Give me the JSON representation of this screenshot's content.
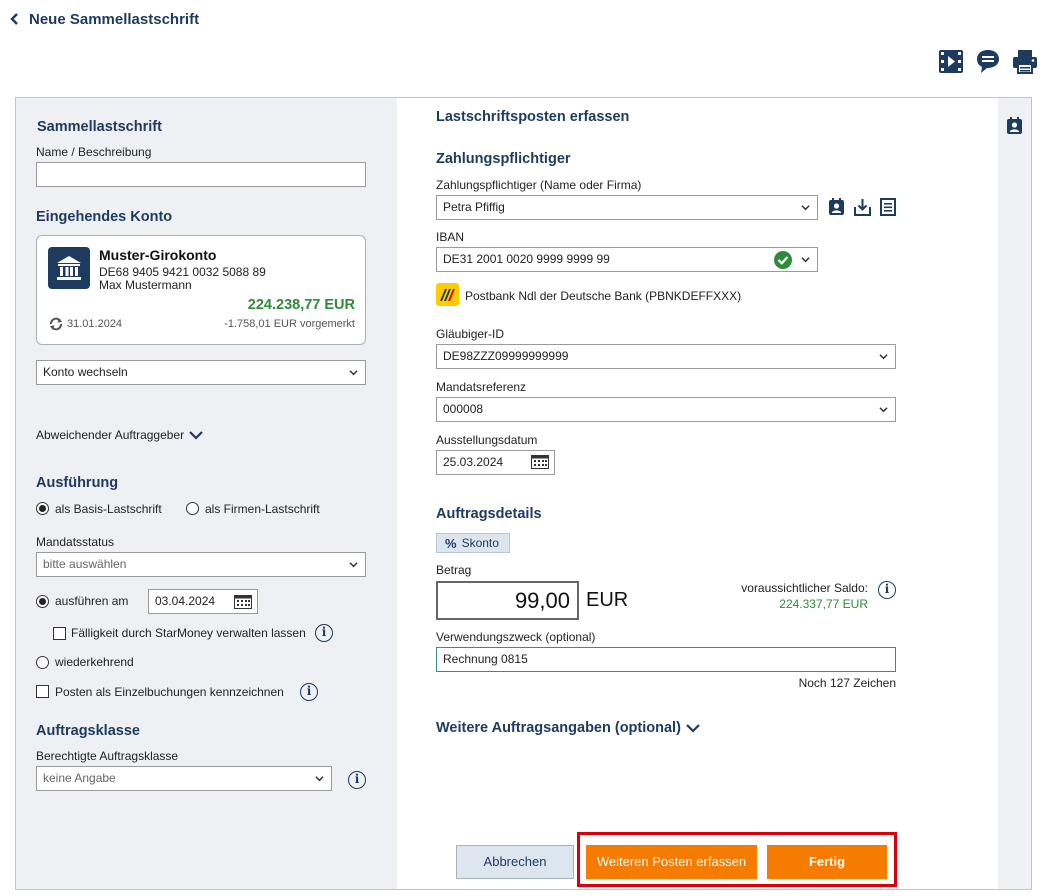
{
  "header": {
    "back_label": "Neue Sammellastschrift"
  },
  "toolbar": {
    "video_icon": "video-icon",
    "chat_icon": "chat-icon",
    "print_icon": "print-icon"
  },
  "left": {
    "section1_title": "Sammellastschrift",
    "name_label": "Name / Beschreibung",
    "name_value": "",
    "account_section_title": "Eingehendes Konto",
    "account": {
      "name": "Muster-Girokonto",
      "iban": "DE68 9405 9421 0032 5088 89",
      "holder": "Max Mustermann",
      "balance": "224.238,77 EUR",
      "date": "31.01.2024",
      "pending": "-1.758,01 EUR vorgemerkt"
    },
    "switch_account": "Konto wechseln",
    "different_payer": "Abweichender Auftraggeber",
    "execution_title": "Ausführung",
    "radio_basis": "als Basis-Lastschrift",
    "radio_firmen": "als Firmen-Lastschrift",
    "mandate_status_label": "Mandatsstatus",
    "mandate_status_placeholder": "bitte auswählen",
    "execute_on_label": "ausführen am",
    "execute_on_date": "03.04.2024",
    "due_manage_label": "Fälligkeit durch StarMoney verwalten lassen",
    "recurring_label": "wiederkehrend",
    "single_booking_label": "Posten als Einzelbuchungen kennzeichnen",
    "order_class_title": "Auftragsklasse",
    "order_class_label": "Berechtigte Auftragsklasse",
    "order_class_value": "keine Angabe"
  },
  "right": {
    "title": "Lastschriftsposten erfassen",
    "payer_title": "Zahlungspflichtiger",
    "payer_label": "Zahlungspflichtiger (Name oder Firma)",
    "payer_value": "Petra Pfiffig",
    "iban_label": "IBAN",
    "iban_value": "DE31 2001 0020 9999 9999 99",
    "bank_name": "Postbank Ndl der Deutsche Bank",
    "bank_bic": "(PBNKDEFFXXX)",
    "creditor_label": "Gläubiger-ID",
    "creditor_value": "DE98ZZZ09999999999",
    "mandate_ref_label": "Mandatsreferenz",
    "mandate_ref_value": "000008",
    "issue_date_label": "Ausstellungsdatum",
    "issue_date_value": "25.03.2024",
    "details_title": "Auftragsdetails",
    "skonto_label": "Skonto",
    "amount_label": "Betrag",
    "amount_value": "99,00",
    "currency": "EUR",
    "expected_balance_label": "voraussichtlicher Saldo:",
    "expected_balance_value": "224.337,77 EUR",
    "purpose_label": "Verwendungszweck (optional)",
    "purpose_value": "Rechnung 0815",
    "chars_left": "Noch 127 Zeichen",
    "more_details": "Weitere Auftragsangaben (optional)"
  },
  "buttons": {
    "cancel": "Abbrechen",
    "add_more": "Weiteren Posten erfassen",
    "finish": "Fertig"
  },
  "colors": {
    "navy": "#1d3a5f",
    "orange": "#f57c00",
    "green": "#2e8b3a",
    "highlight": "#d8000c"
  }
}
